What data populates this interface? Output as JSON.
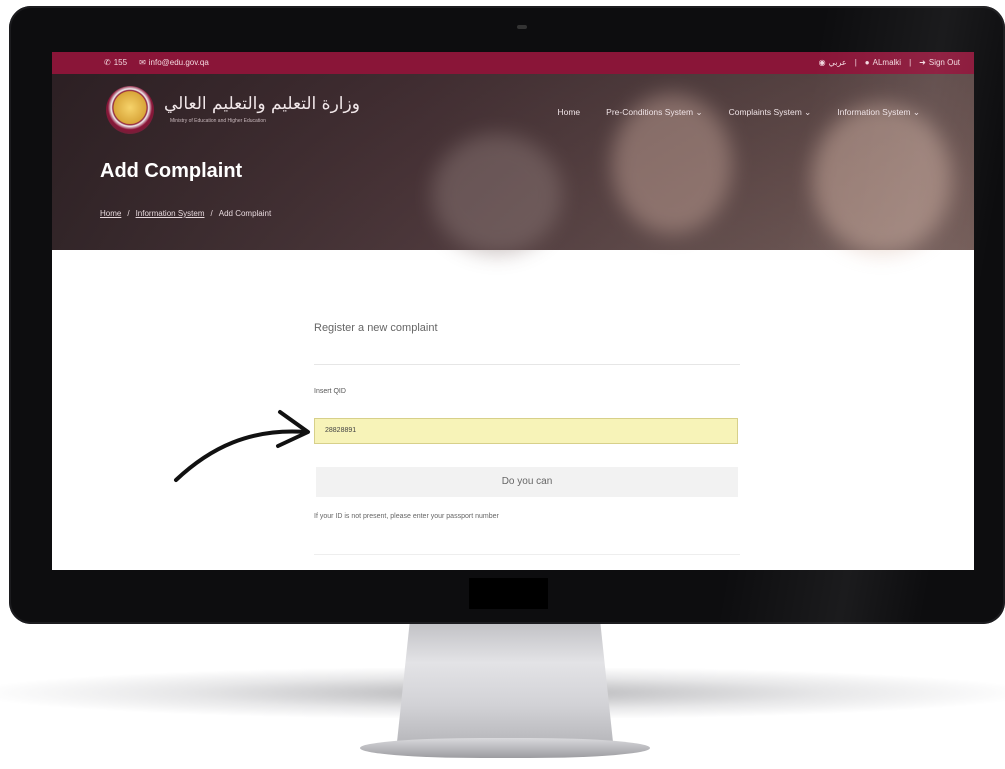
{
  "topbar": {
    "phone": "155",
    "email": "info@edu.gov.qa",
    "language": "عربي",
    "user": "ALmalki",
    "signout": "Sign Out"
  },
  "header": {
    "logo_text": "وزارة التعليم والتعليم العالي",
    "logo_subtext": "Ministry of Education and Higher Education",
    "nav": [
      "Home",
      "Pre-Conditions System ⌄",
      "Complaints System ⌄",
      "Information System ⌄"
    ]
  },
  "page": {
    "title": "Add Complaint",
    "breadcrumb": [
      "Home",
      "Information System",
      "Add Complaint"
    ]
  },
  "form": {
    "heading": "Register a new complaint",
    "field_label": "Insert QID",
    "field_value": "28828891",
    "button_label": "Do you can",
    "hint": "If your ID is not present, please enter your passport number"
  },
  "colors": {
    "brand": "#8a1538",
    "input_bg": "#f7f3b8"
  }
}
